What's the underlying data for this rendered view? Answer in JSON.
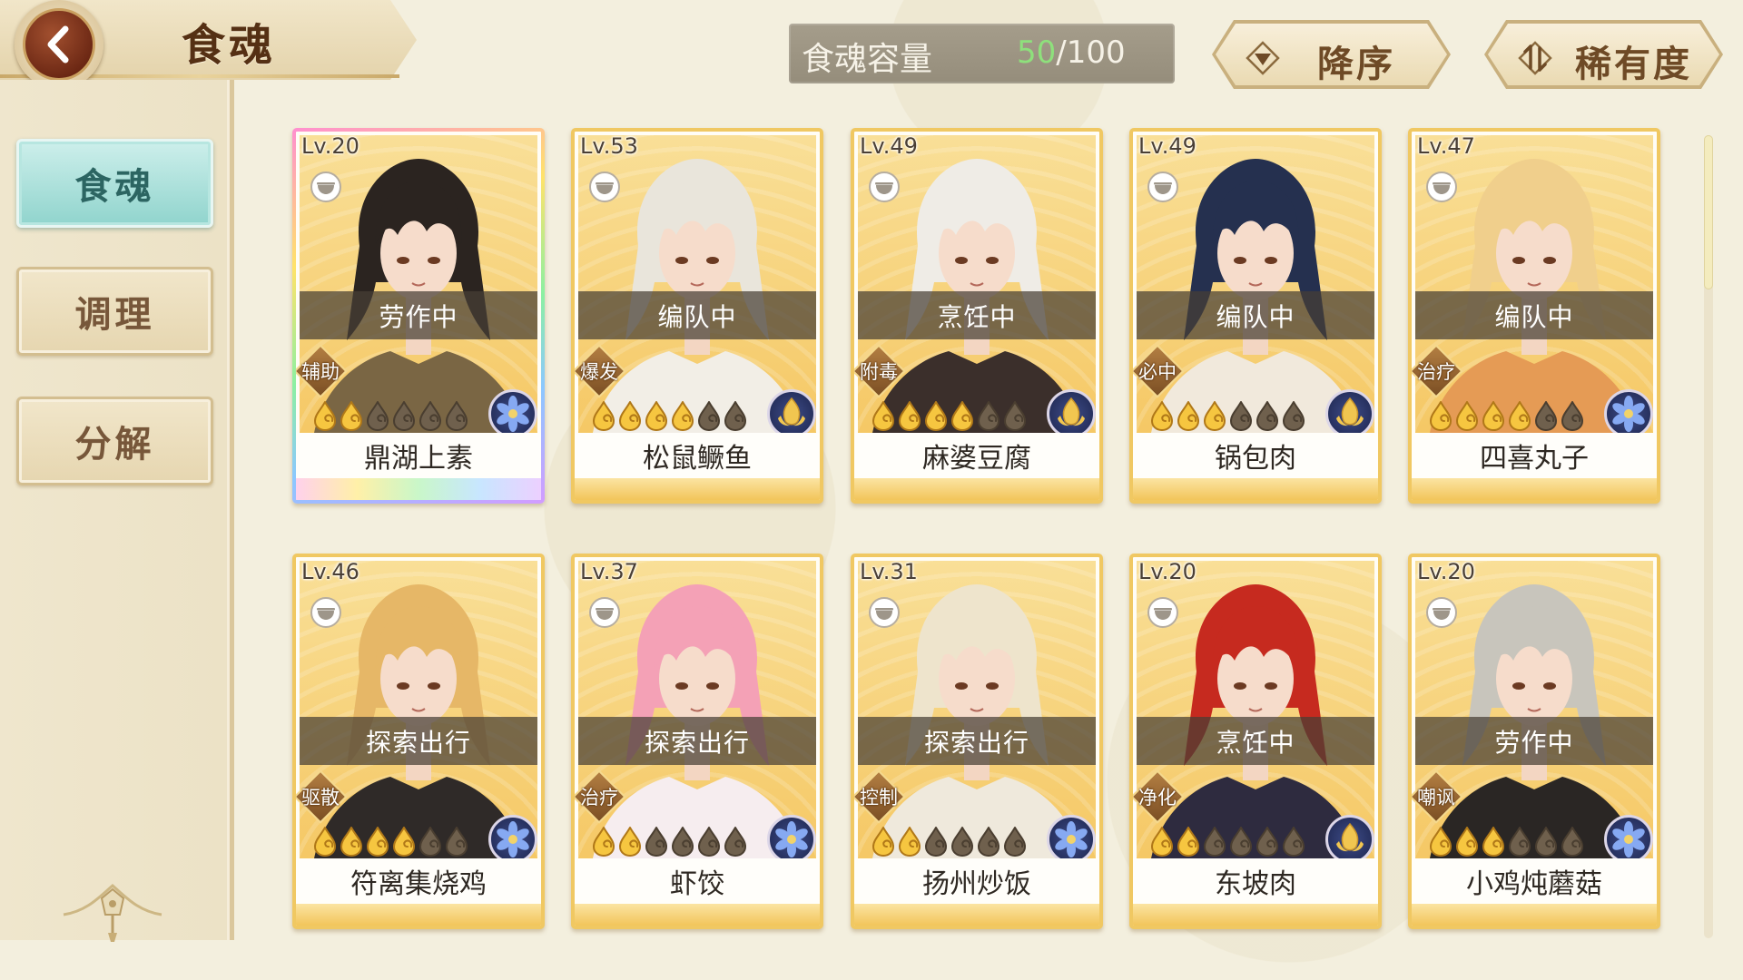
{
  "header": {
    "title": "食魂",
    "back_icon": "chevron-left-icon"
  },
  "capacity": {
    "label": "食魂容量",
    "current": "50",
    "max": "/100",
    "current_color": "#8ee07c"
  },
  "sort": {
    "order_label": "降序",
    "order_icon": "sort-desc-icon",
    "field_label": "稀有度",
    "field_icon": "swap-vertical-icon"
  },
  "sidebar": {
    "items": [
      {
        "label": "食魂",
        "active": true
      },
      {
        "label": "调理",
        "active": false
      },
      {
        "label": "分解",
        "active": false
      }
    ]
  },
  "colors": {
    "card_frame": "#f0c862",
    "status_banner": "#463e34",
    "active_tab": "#90d4cd"
  },
  "cards": [
    {
      "level": "Lv.20",
      "status": "劳作中",
      "role": "辅助",
      "name": "鼎湖上素",
      "flames_lit": 2,
      "flames_total": 6,
      "element_icon": "blue-flower-icon",
      "frame": "rainbow",
      "hair_color": "#2b2420",
      "outfit_color": "#7a6644"
    },
    {
      "level": "Lv.53",
      "status": "编队中",
      "role": "爆发",
      "name": "松鼠鳜鱼",
      "flames_lit": 4,
      "flames_total": 6,
      "element_icon": "gold-flower-icon",
      "frame": "gold",
      "hair_color": "#e9e5db",
      "outfit_color": "#f2eee6"
    },
    {
      "level": "Lv.49",
      "status": "烹饪中",
      "role": "附毒",
      "name": "麻婆豆腐",
      "flames_lit": 4,
      "flames_total": 6,
      "element_icon": "gold-flower-icon",
      "frame": "gold",
      "hair_color": "#efece6",
      "outfit_color": "#3b2f2b"
    },
    {
      "level": "Lv.49",
      "status": "编队中",
      "role": "必中",
      "name": "锅包肉",
      "flames_lit": 3,
      "flames_total": 6,
      "element_icon": "gold-flower-icon",
      "frame": "gold",
      "hair_color": "#25304f",
      "outfit_color": "#f1e9dc"
    },
    {
      "level": "Lv.47",
      "status": "编队中",
      "role": "治疗",
      "name": "四喜丸子",
      "flames_lit": 4,
      "flames_total": 6,
      "element_icon": "blue-flower-icon",
      "frame": "gold",
      "hair_color": "#f0cf8c",
      "outfit_color": "#e59b55"
    },
    {
      "level": "Lv.46",
      "status": "探索出行",
      "role": "驱散",
      "name": "符离集烧鸡",
      "flames_lit": 4,
      "flames_total": 6,
      "element_icon": "blue-flower-icon",
      "frame": "gold",
      "hair_color": "#e6b767",
      "outfit_color": "#2f2a28"
    },
    {
      "level": "Lv.37",
      "status": "探索出行",
      "role": "治疗",
      "name": "虾饺",
      "flames_lit": 2,
      "flames_total": 6,
      "element_icon": "blue-flower-icon",
      "frame": "gold",
      "hair_color": "#f4a1b6",
      "outfit_color": "#f6edef"
    },
    {
      "level": "Lv.31",
      "status": "探索出行",
      "role": "控制",
      "name": "扬州炒饭",
      "flames_lit": 2,
      "flames_total": 6,
      "element_icon": "blue-flower-icon",
      "frame": "gold",
      "hair_color": "#eee4cc",
      "outfit_color": "#efe9dc"
    },
    {
      "level": "Lv.20",
      "status": "烹饪中",
      "role": "净化",
      "name": "东坡肉",
      "flames_lit": 2,
      "flames_total": 6,
      "element_icon": "gold-flower-icon",
      "frame": "gold",
      "hair_color": "#c62a1f",
      "outfit_color": "#2e2b3f"
    },
    {
      "level": "Lv.20",
      "status": "劳作中",
      "role": "嘲讽",
      "name": "小鸡炖蘑菇",
      "flames_lit": 3,
      "flames_total": 6,
      "element_icon": "blue-flower-icon",
      "frame": "gold",
      "hair_color": "#c8c5bc",
      "outfit_color": "#2a2624"
    }
  ]
}
